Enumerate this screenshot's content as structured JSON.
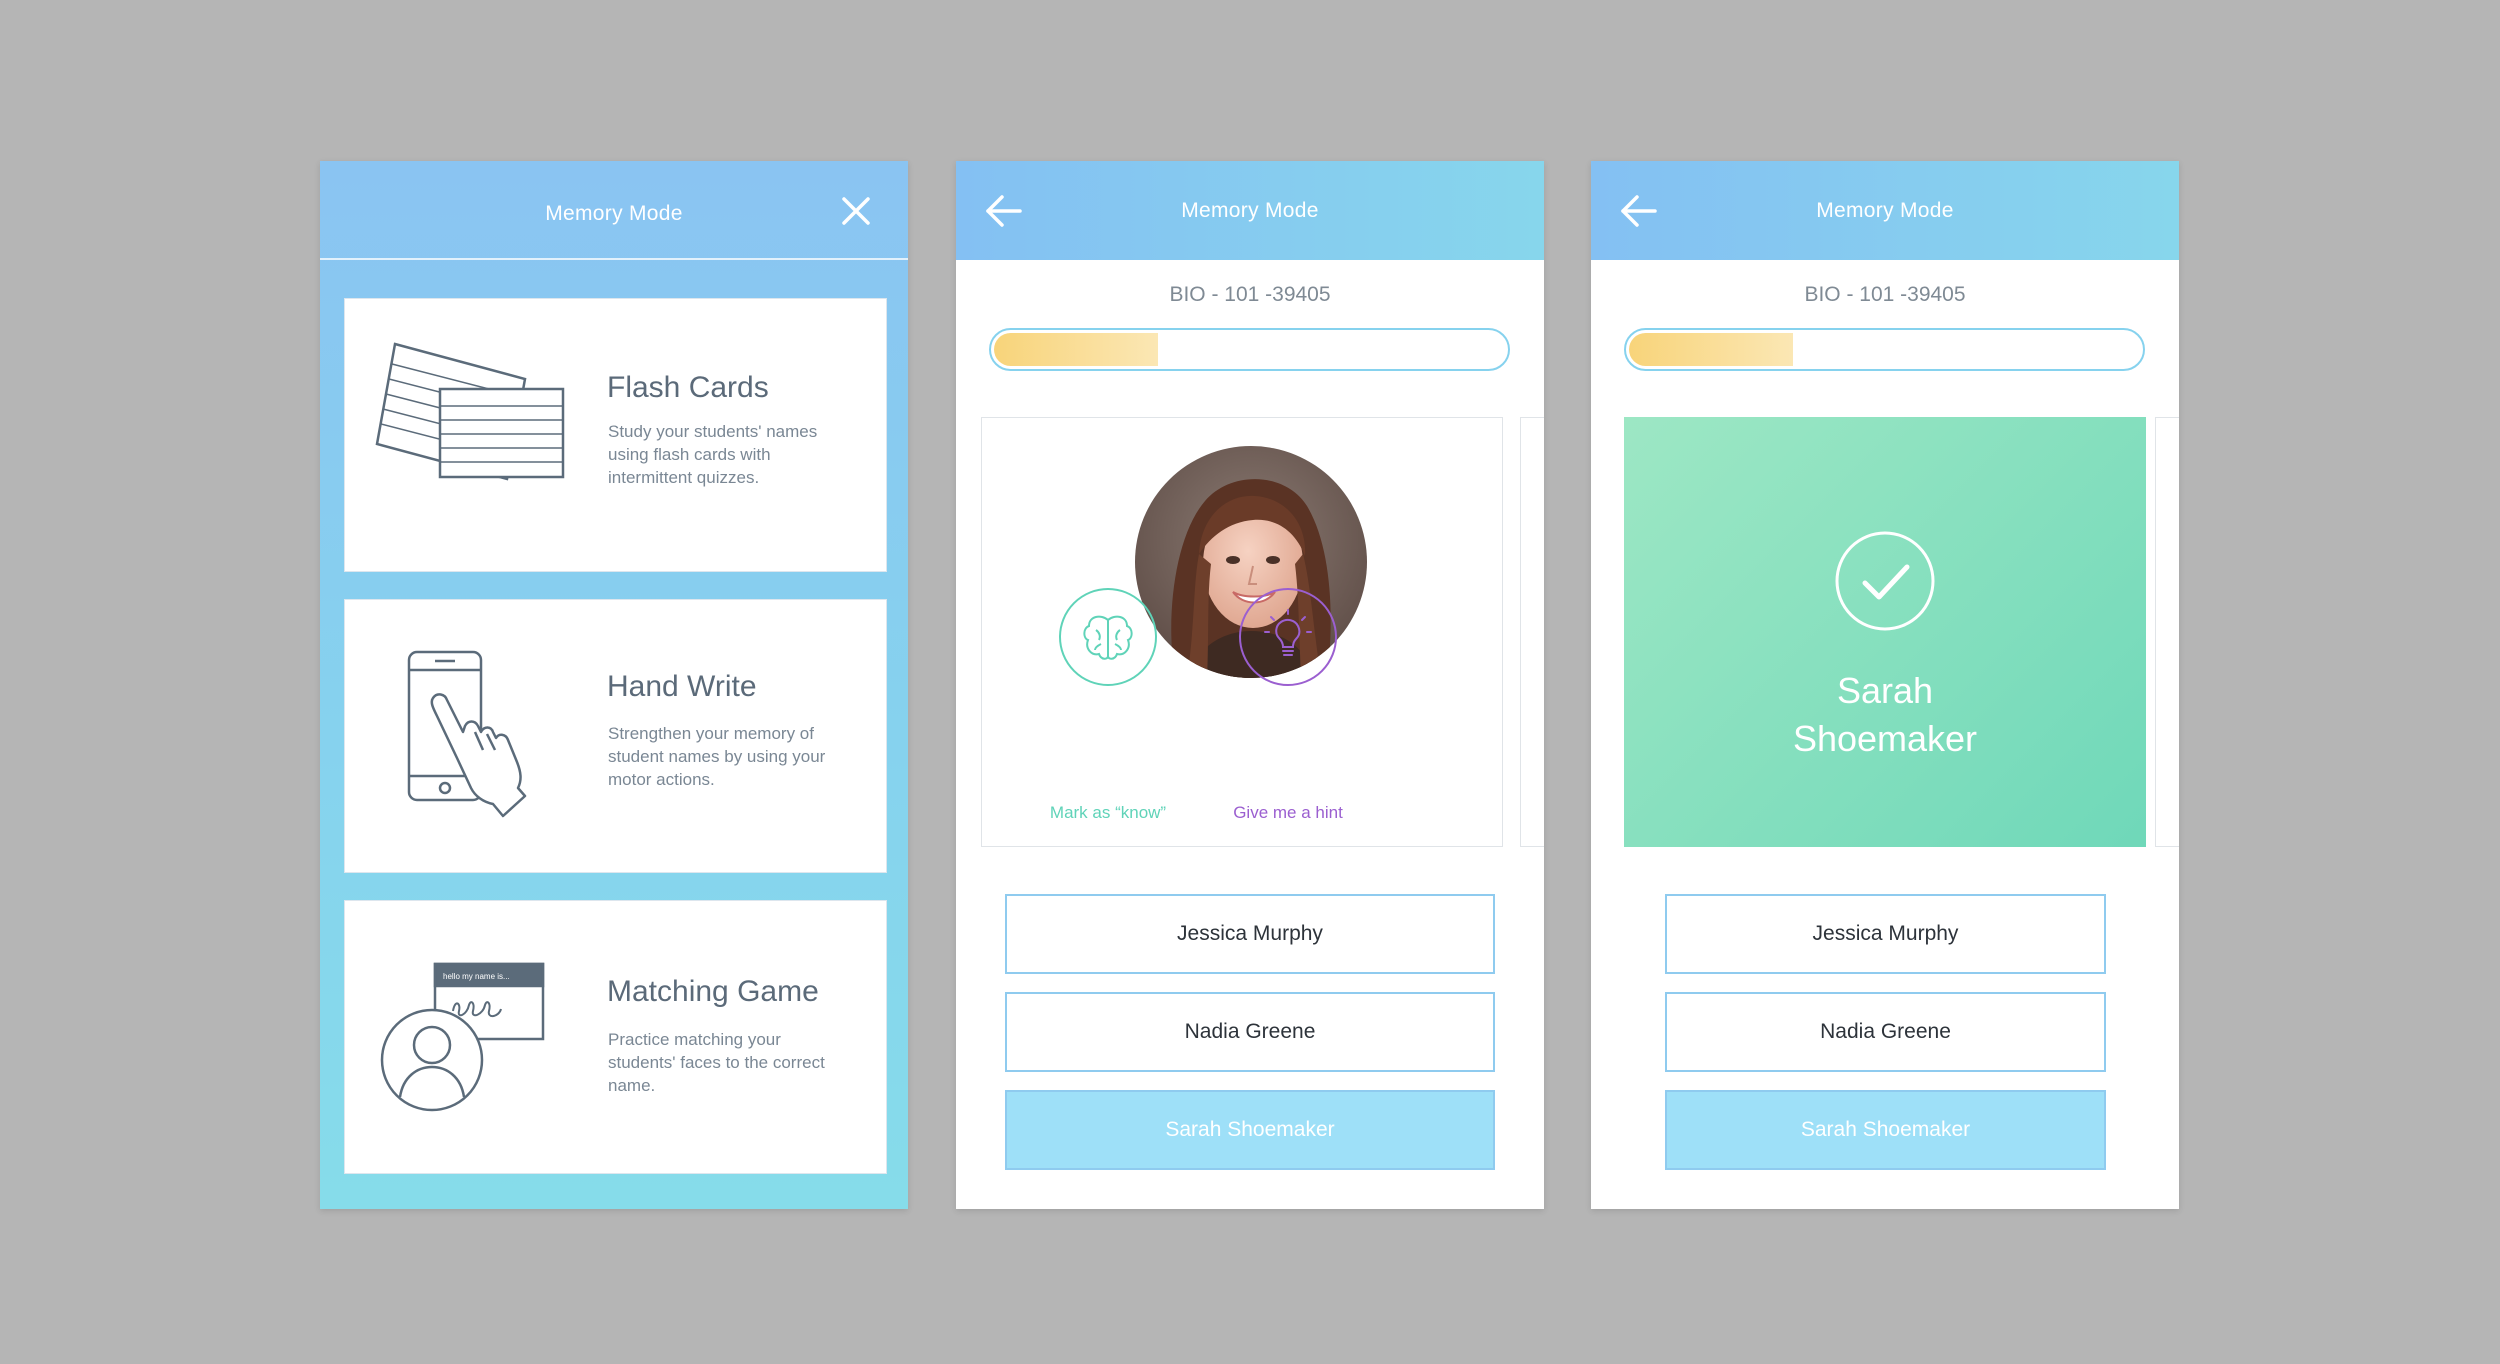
{
  "screen1": {
    "header": {
      "title": "Memory Mode"
    },
    "modes": [
      {
        "title": "Flash Cards",
        "description": "Study your students' names using flash cards with intermittent quizzes."
      },
      {
        "title": "Hand Write",
        "description": "Strengthen your memory of student names by using your motor actions."
      },
      {
        "title": "Matching Game",
        "description": "Practice matching your students' faces to the correct name.",
        "tag_text": "hello my name is..."
      }
    ]
  },
  "screen2": {
    "header": {
      "title": "Memory Mode"
    },
    "course_code": "BIO - 101 -39405",
    "progress": 0.32,
    "actions": {
      "know_label": "Mark as “know”",
      "hint_label": "Give me a hint"
    },
    "answers": [
      "Jessica Murphy",
      "Nadia Greene",
      "Sarah Shoemaker"
    ]
  },
  "screen3": {
    "header": {
      "title": "Memory Mode"
    },
    "course_code": "BIO - 101 -39405",
    "progress": 0.32,
    "correct_name_line1": "Sarah",
    "correct_name_line2": "Shoemaker",
    "answers": [
      "Jessica Murphy",
      "Nadia Greene",
      "Sarah Shoemaker"
    ]
  },
  "colors": {
    "background": "#b5b5b5",
    "header_gradient_start": "#84c0f3",
    "header_gradient_end": "#87d6ec",
    "success_green": "#7ddfbf",
    "know_teal": "#5fd3b8",
    "hint_purple": "#9b5fd0",
    "progress_yellow": "#f8d47a",
    "answer_selected": "#9ee0f8"
  },
  "icons": [
    "close-icon",
    "back-arrow-icon",
    "brain-icon",
    "lightbulb-icon",
    "checkmark-icon",
    "flash-cards-illustration",
    "phone-hand-illustration",
    "name-tag-illustration"
  ]
}
